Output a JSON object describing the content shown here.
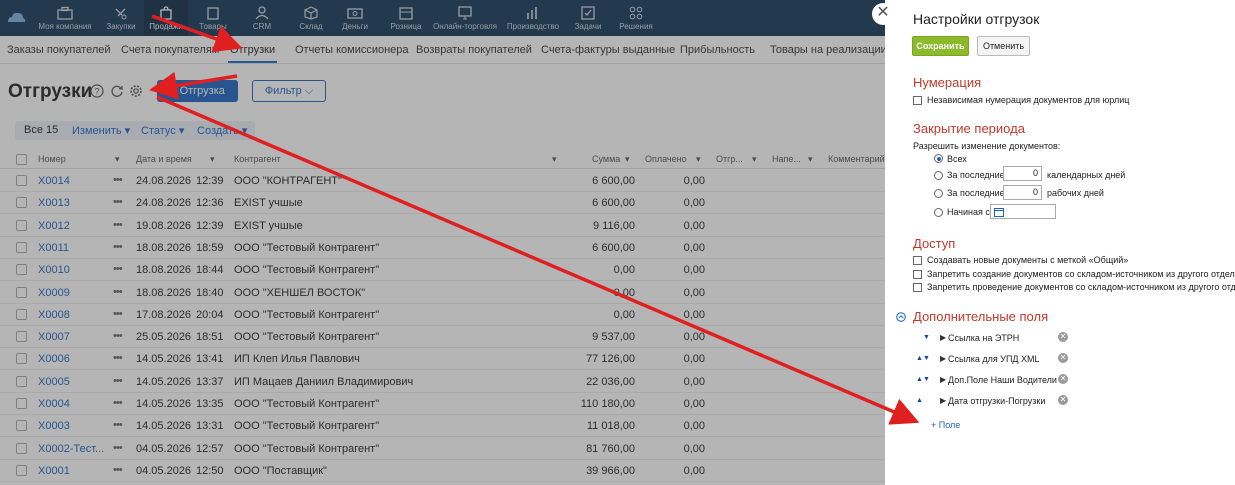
{
  "nav": {
    "items": [
      {
        "label": "Моя компания",
        "icon": "briefcase-icon"
      },
      {
        "label": "Закупки",
        "icon": "truck-icon"
      },
      {
        "label": "Продажи",
        "icon": "bag-icon",
        "active": true
      },
      {
        "label": "Товары",
        "icon": "box-icon"
      },
      {
        "label": "CRM",
        "icon": "users-icon"
      },
      {
        "label": "Склад",
        "icon": "cube-icon"
      },
      {
        "label": "Деньги",
        "icon": "money-icon"
      },
      {
        "label": "Розница",
        "icon": "store-icon"
      },
      {
        "label": "Онлайн-торговля",
        "icon": "monitor-icon"
      },
      {
        "label": "Производство",
        "icon": "chart-icon"
      },
      {
        "label": "Задачи",
        "icon": "checkbox-icon"
      },
      {
        "label": "Решения",
        "icon": "grid-icon"
      }
    ]
  },
  "subnav": {
    "items": [
      "Заказы покупателей",
      "Счета покупателям",
      "Отгрузки",
      "Отчеты комиссионера",
      "Возвраты покупателей",
      "Счета-фактуры выданные",
      "Прибыльность",
      "Товары на реализации"
    ],
    "active_index": 2
  },
  "page": {
    "title": "Отгрузки",
    "add_button": "+ Отгрузка",
    "filter_button": "Фильтр"
  },
  "toolbar": {
    "all": "Все 15",
    "change": "Изменить",
    "status": "Статус",
    "create": "Создать"
  },
  "table": {
    "headers": [
      "Номер",
      "Дата и время",
      "Контрагент",
      "Сумма",
      "Оплачено",
      "Отгр...",
      "Напе...",
      "Комментарий"
    ],
    "rows": [
      {
        "num": "X0014",
        "date": "24.08.2026",
        "time": "12:39",
        "agent": "ООО \"КОНТРАГЕНТ\"",
        "sum": "6 600,00",
        "paid": "0,00"
      },
      {
        "num": "X0013",
        "date": "24.08.2026",
        "time": "12:36",
        "agent": "EXIST учшые",
        "sum": "6 600,00",
        "paid": "0,00"
      },
      {
        "num": "X0012",
        "date": "19.08.2026",
        "time": "12:39",
        "agent": "EXIST учшые",
        "sum": "9 116,00",
        "paid": "0,00"
      },
      {
        "num": "X0011",
        "date": "18.08.2026",
        "time": "18:59",
        "agent": "ООО \"Тестовый Контрагент\"",
        "sum": "6 600,00",
        "paid": "0,00"
      },
      {
        "num": "X0010",
        "date": "18.08.2026",
        "time": "18:44",
        "agent": "ООО \"Тестовый Контрагент\"",
        "sum": "0,00",
        "paid": "0,00"
      },
      {
        "num": "X0009",
        "date": "18.08.2026",
        "time": "18:40",
        "agent": "ООО \"ХЕНШЕЛ ВОСТОК\"",
        "sum": "0,00",
        "paid": "0,00"
      },
      {
        "num": "X0008",
        "date": "17.08.2026",
        "time": "20:04",
        "agent": "ООО \"Тестовый Контрагент\"",
        "sum": "0,00",
        "paid": "0,00"
      },
      {
        "num": "X0007",
        "date": "25.05.2026",
        "time": "18:51",
        "agent": "ООО \"Тестовый Контрагент\"",
        "sum": "9 537,00",
        "paid": "0,00"
      },
      {
        "num": "X0006",
        "date": "14.05.2026",
        "time": "13:41",
        "agent": "ИП Клеп Илья Павлович",
        "sum": "77 126,00",
        "paid": "0,00"
      },
      {
        "num": "X0005",
        "date": "14.05.2026",
        "time": "13:37",
        "agent": "ИП Мацаев Даниил Владимирович",
        "sum": "22 036,00",
        "paid": "0,00"
      },
      {
        "num": "X0004",
        "date": "14.05.2026",
        "time": "13:35",
        "agent": "ООО \"Тестовый Контрагент\"",
        "sum": "110 180,00",
        "paid": "0,00"
      },
      {
        "num": "X0003",
        "date": "14.05.2026",
        "time": "13:31",
        "agent": "ООО \"Тестовый Контрагент\"",
        "sum": "11 018,00",
        "paid": "0,00"
      },
      {
        "num": "X0002-Тест...",
        "date": "04.05.2026",
        "time": "12:57",
        "agent": "ООО \"Тестовый Контрагент\"",
        "sum": "81 760,00",
        "paid": "0,00"
      },
      {
        "num": "X0001",
        "date": "04.05.2026",
        "time": "12:50",
        "agent": "ООО \"Поставщик\"",
        "sum": "39 966,00",
        "paid": "0,00"
      }
    ]
  },
  "panel": {
    "title": "Настройки отгрузок",
    "save": "Сохранить",
    "cancel": "Отменить",
    "numbering": {
      "title": "Нумерация",
      "opt1": "Независимая нумерация документов для юрлиц"
    },
    "period": {
      "title": "Закрытие периода",
      "label": "Разрешить изменение документов:",
      "all": "Всех",
      "last": "За последние",
      "calendar_value": "0",
      "calendar_days": "календарных дней",
      "work_value": "0",
      "work_days": "рабочих дней",
      "starting": "Начиная с"
    },
    "access": {
      "title": "Доступ",
      "opt1": "Создавать новые документы с меткой «Общий»",
      "opt2": "Запретить создание документов со складом-источником из другого отдела",
      "opt3": "Запретить проведение документов со складом-источником из другого отдела"
    },
    "extra": {
      "title": "Дополнительные поля",
      "fields": [
        "Ссылка на ЭТРН",
        "Ссылка для УПД XML",
        "Доп.Поле Наши Водители",
        "Дата отгрузки-Погрузки"
      ],
      "add": "+ Поле"
    }
  },
  "colors": {
    "nav_bg": "#14385a",
    "accent": "#1c63c4",
    "section_title": "#c0392b",
    "save_green": "#8bba2a",
    "annotation_arrow": "#e02020"
  }
}
